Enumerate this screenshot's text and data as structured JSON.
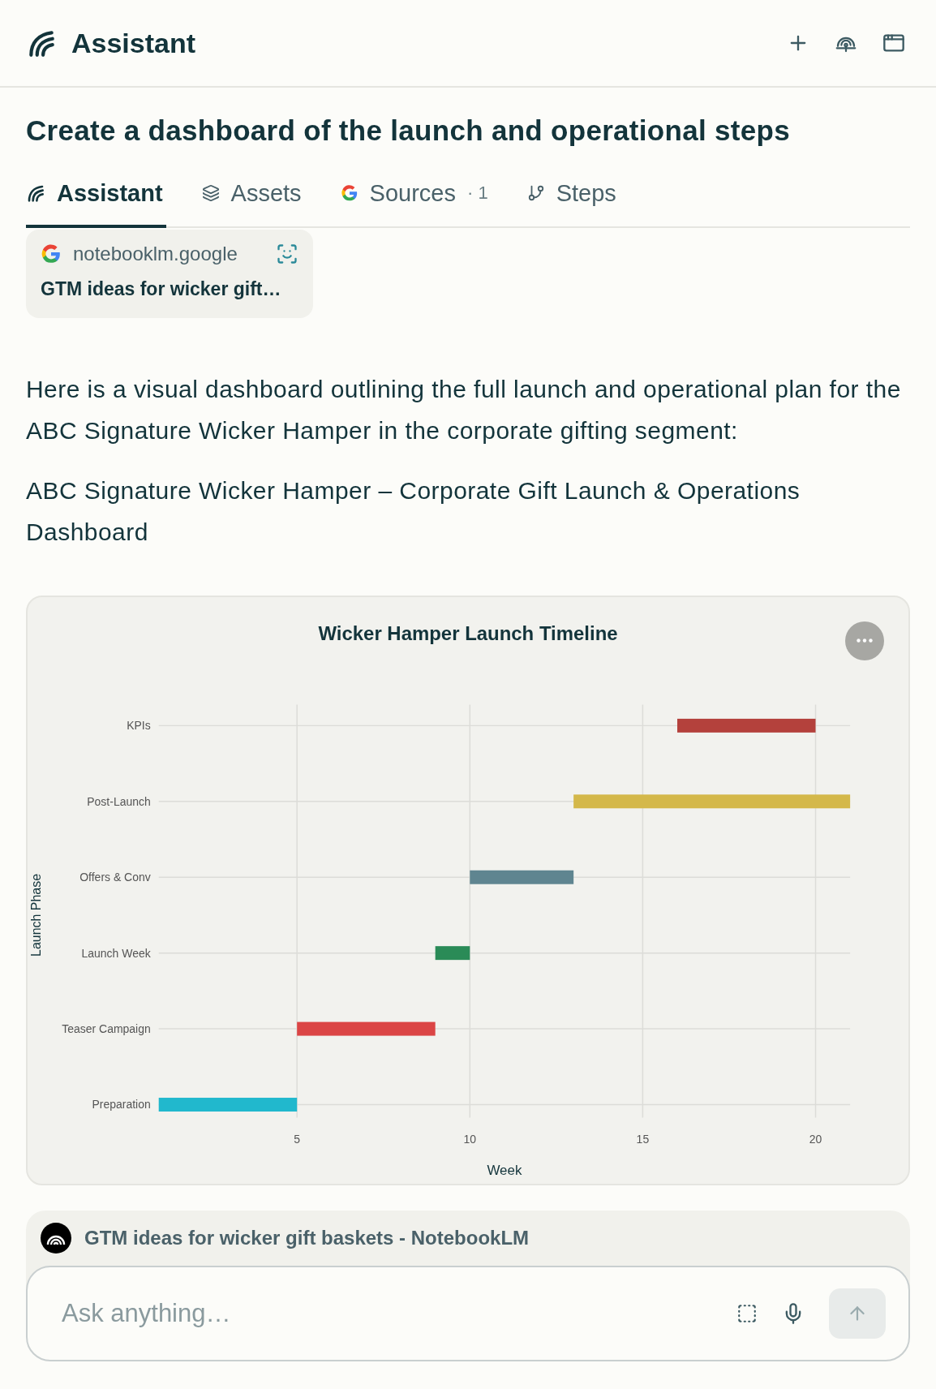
{
  "header": {
    "title": "Assistant"
  },
  "question": "Create a dashboard of the launch and operational steps",
  "tabs": [
    {
      "label": "Assistant",
      "selected": true
    },
    {
      "label": "Assets",
      "selected": false
    },
    {
      "label": "Sources",
      "count": "· 1",
      "selected": false
    },
    {
      "label": "Steps",
      "selected": false
    }
  ],
  "source_chip": {
    "domain": "notebooklm.google",
    "title": "GTM ideas for wicker gift…"
  },
  "message": {
    "paragraphs": [
      "Here is a visual dashboard outlining the full launch and operational plan for the ABC Signature Wicker Hamper in the corporate gifting segment:",
      "ABC Signature Wicker Hamper – Corporate Gift Launch & Operations Dashboard"
    ]
  },
  "chart": {
    "chart_data": {
      "type": "bar",
      "orientation": "horizontal",
      "title": "Wicker Hamper Launch Timeline",
      "xlabel": "Week",
      "ylabel": "Launch Phase",
      "categories": [
        "KPIs",
        "Post-Launch",
        "Offers & Conv",
        "Launch Week",
        "Teaser Campaign",
        "Preparation"
      ],
      "values": [
        4,
        8,
        3,
        1,
        4,
        4
      ],
      "base": [
        16,
        13,
        10,
        9,
        5,
        1
      ],
      "colors": [
        "#b4413c",
        "#d4b84a",
        "#5f8590",
        "#2a8b57",
        "#db4545",
        "#21b8cd"
      ],
      "xlim": [
        1,
        21
      ],
      "xticks": [
        5,
        10,
        15,
        20
      ],
      "grid": true
    }
  },
  "context_bar": {
    "title": "GTM ideas for wicker gift baskets - NotebookLM"
  },
  "composer": {
    "placeholder": "Ask anything…",
    "send_disabled": true
  }
}
